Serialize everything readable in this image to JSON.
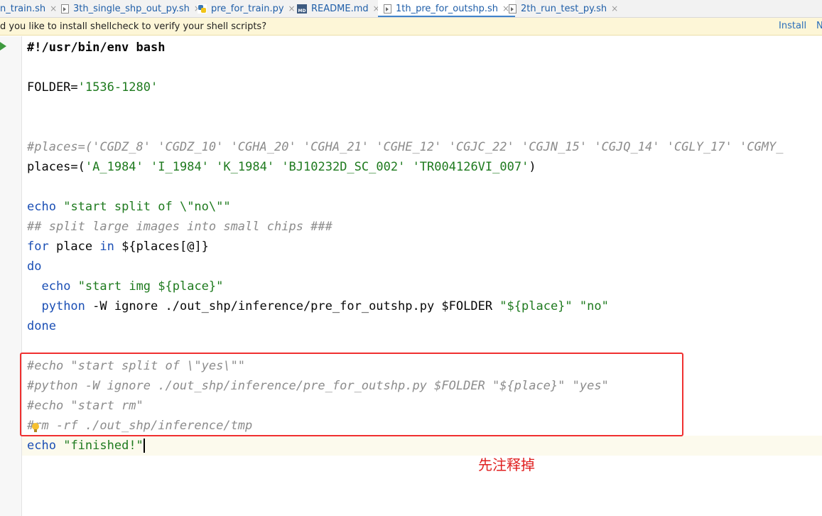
{
  "tabs": [
    {
      "label": "n_train.sh",
      "icon": "shell-file-icon",
      "active": false
    },
    {
      "label": "3th_single_shp_out_py.sh",
      "icon": "shell-file-icon",
      "active": false
    },
    {
      "label": "pre_for_train.py",
      "icon": "python-file-icon",
      "active": false
    },
    {
      "label": "README.md",
      "icon": "markdown-file-icon",
      "active": false
    },
    {
      "label": "1th_pre_for_outshp.sh",
      "icon": "shell-file-icon",
      "active": true
    },
    {
      "label": "2th_run_test_py.sh",
      "icon": "shell-file-icon",
      "active": false
    }
  ],
  "tab_close_glyph": "×",
  "notification": {
    "message": "d you like to install shellcheck to verify your shell scripts?",
    "install_label": "Install",
    "more_label": "N"
  },
  "code": {
    "l01": "#!/usr/bin/env bash",
    "l03_a": "FOLDER=",
    "l03_b": "'1536-1280'",
    "l06": "#places=('CGDZ_8' 'CGDZ_10' 'CGHA_20' 'CGHA_21' 'CGHE_12' 'CGJC_22' 'CGJN_15' 'CGJQ_14' 'CGLY_17' 'CGMY_",
    "l07_a": "places=(",
    "l07_b": "'A_1984'",
    "l07_c": "'I_1984'",
    "l07_d": "'K_1984'",
    "l07_e": "'BJ10232D_SC_002'",
    "l07_f": "'TR004126VI_007'",
    "l07_g": ")",
    "l09_a": "echo",
    "l09_b": "\"start split of \\\"no\\\"\"",
    "l10": "## split large images into small chips ###",
    "l11_a": "for",
    "l11_b": " place ",
    "l11_c": "in",
    "l11_d": " ${places[@]}",
    "l12": "do",
    "l13_a": "echo",
    "l13_b": "\"start img ${place}\"",
    "l14_a": "python",
    "l14_b": " -W ignore ./out_shp/inference/pre_for_outshp.py $FOLDER ",
    "l14_c": "\"${place}\"",
    "l14_d": "\"no\"",
    "l15": "done",
    "l17": "#echo \"start split of \\\"yes\\\"\"",
    "l18": "#python -W ignore ./out_shp/inference/pre_for_outshp.py $FOLDER \"${place}\" \"yes\"",
    "l19": "#echo \"start rm\"",
    "l20": "#rm -rf ./out_shp/inference/tmp",
    "l21_a": "echo",
    "l21_b": "\"finished!\""
  },
  "annotation": "先注释掉",
  "colors": {
    "keyword": "#1b4fb5",
    "string": "#1e7a1e",
    "comment": "#8c8c8c",
    "highlight_box": "#f03030"
  }
}
